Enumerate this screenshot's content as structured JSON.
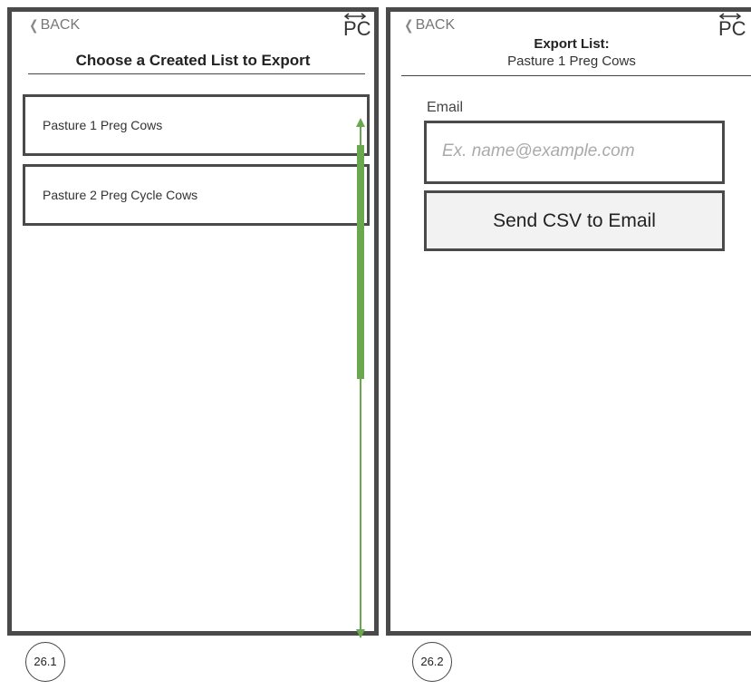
{
  "screens": [
    {
      "back_label": "BACK",
      "pc_label": "PC",
      "title": "Choose a Created List to Export",
      "items": [
        {
          "label": "Pasture 1 Preg Cows"
        },
        {
          "label": "Pasture 2 Preg Cycle Cows"
        }
      ],
      "scrollbar_color": "#6aa84f",
      "tag": "26.1"
    },
    {
      "back_label": "BACK",
      "pc_label": "PC",
      "title": "Export List:",
      "subtitle": "Pasture 1 Preg Cows",
      "email_label": "Email",
      "email_value": "",
      "email_placeholder": "Ex. name@example.com",
      "send_label": "Send CSV to Email",
      "tag": "26.2"
    }
  ],
  "icons": {
    "back": "chevron-left-icon",
    "pc": "pc-swap-icon"
  }
}
